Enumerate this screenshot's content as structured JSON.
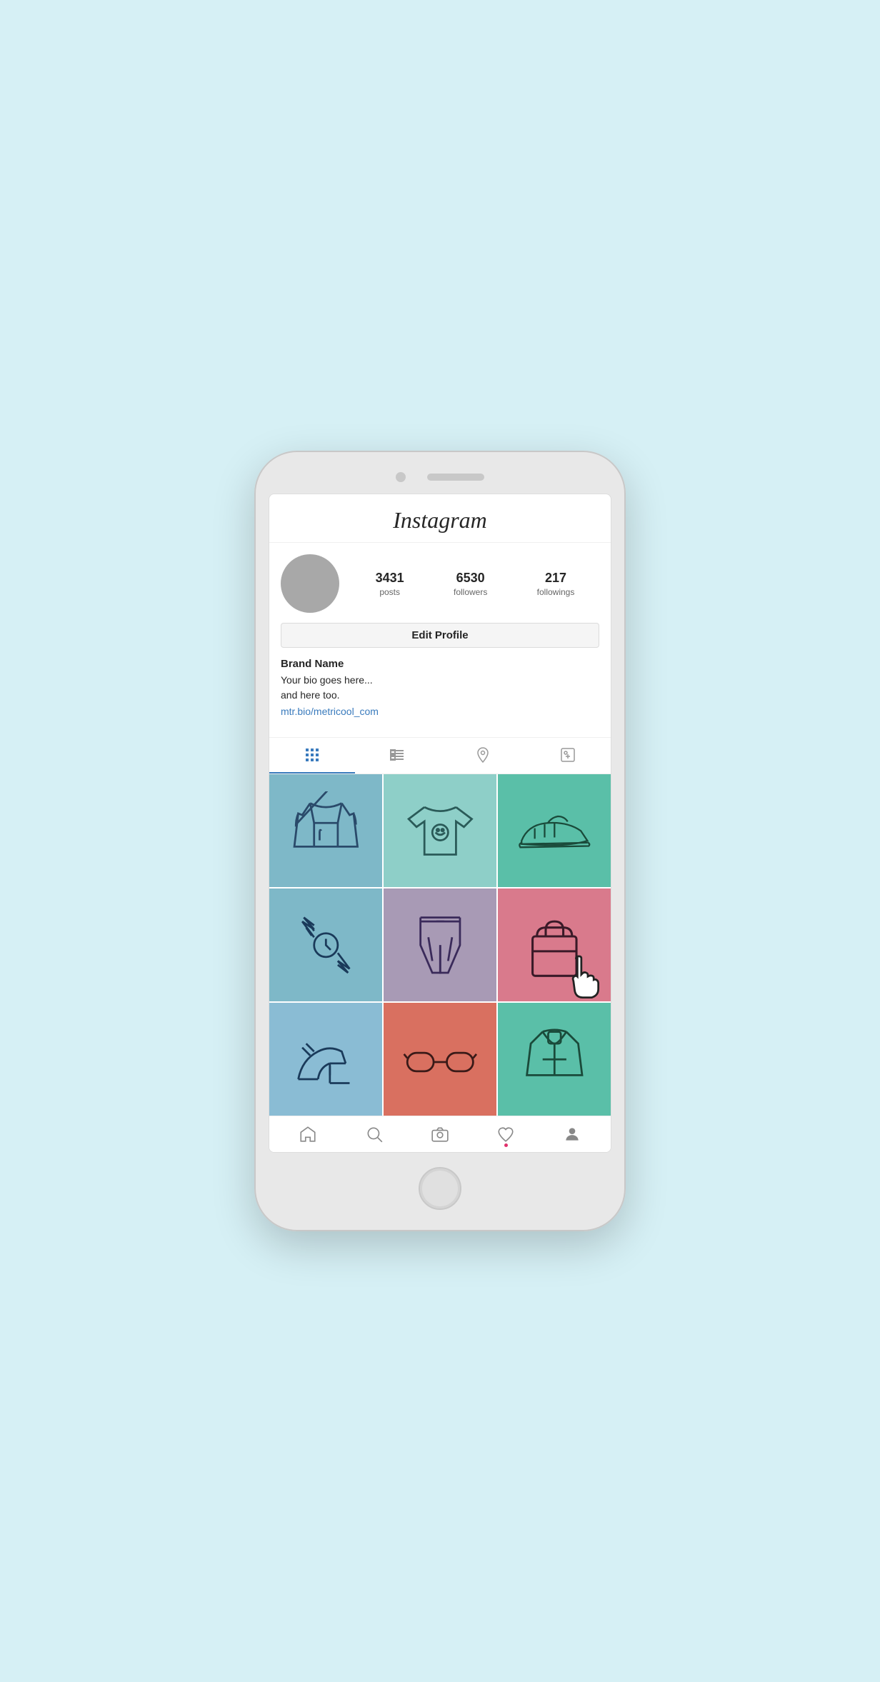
{
  "app": {
    "title": "Instagram",
    "background_color": "#d6f0f5"
  },
  "profile": {
    "avatar_bg": "#a8a8a8",
    "stats": {
      "posts_count": "3431",
      "posts_label": "posts",
      "followers_count": "6530",
      "followers_label": "followers",
      "following_count": "217",
      "following_label": "followings"
    },
    "edit_profile_label": "Edit Profile",
    "brand_name": "Brand Name",
    "bio_line1": "Your bio goes here...",
    "bio_line2": "and here too.",
    "bio_link": "mtr.bio/metricool_com"
  },
  "tabs": {
    "grid_label": "Grid",
    "list_label": "List",
    "location_label": "Location",
    "tagged_label": "Tagged"
  },
  "grid": {
    "items": [
      {
        "color": "steel-blue",
        "item": "jacket"
      },
      {
        "color": "teal-light",
        "item": "tshirt"
      },
      {
        "color": "green-teal",
        "item": "sneaker"
      },
      {
        "color": "light-steel",
        "item": "watch"
      },
      {
        "color": "mauve",
        "item": "pants"
      },
      {
        "color": "pink",
        "item": "bag"
      },
      {
        "color": "light-blue2",
        "item": "heels"
      },
      {
        "color": "coral",
        "item": "sunglasses"
      },
      {
        "color": "teal2",
        "item": "hoodie"
      }
    ]
  },
  "nav": {
    "home_label": "Home",
    "search_label": "Search",
    "camera_label": "Camera",
    "heart_label": "Activity",
    "profile_label": "Profile"
  }
}
